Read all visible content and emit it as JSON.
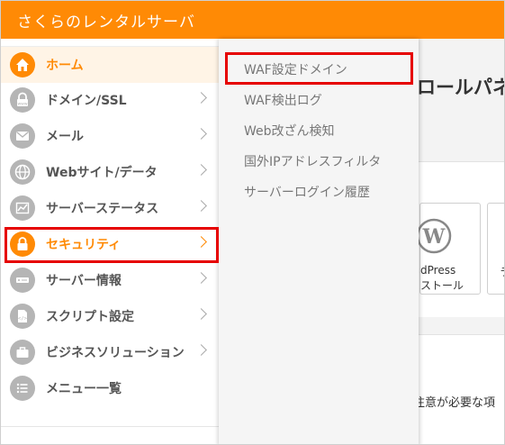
{
  "app": {
    "title": "さくらのレンタルサーバ"
  },
  "sidebar": {
    "items": [
      {
        "label": "ホーム",
        "icon": "home-icon"
      },
      {
        "label": "ドメイン/SSL",
        "icon": "lock-www-icon"
      },
      {
        "label": "メール",
        "icon": "mail-icon"
      },
      {
        "label": "Webサイト/データ",
        "icon": "globe-icon"
      },
      {
        "label": "サーバーステータス",
        "icon": "chart-icon"
      },
      {
        "label": "セキュリティ",
        "icon": "padlock-icon"
      },
      {
        "label": "サーバー情報",
        "icon": "server-icon"
      },
      {
        "label": "スクリプト設定",
        "icon": "script-file-icon"
      },
      {
        "label": "ビジネスソリューション",
        "icon": "briefcase-icon"
      },
      {
        "label": "メニュー一覧",
        "icon": "list-icon"
      }
    ],
    "active_item": "セキュリティ"
  },
  "submenu": {
    "items": [
      {
        "label": "WAF設定ドメイン"
      },
      {
        "label": "WAF検出ログ"
      },
      {
        "label": "Web改ざん検知"
      },
      {
        "label": "国外IPアドレスフィルタ"
      },
      {
        "label": "サーバーログイン履歴"
      }
    ]
  },
  "main": {
    "heading": "ロールパネ",
    "tile_line1": "dPress",
    "tile_line2": "ストール",
    "tile2_char": "ラ",
    "notice": "注意が必要な項"
  },
  "colors": {
    "accent": "#ff8a05",
    "highlight": "#e60000",
    "text": "#555555"
  }
}
